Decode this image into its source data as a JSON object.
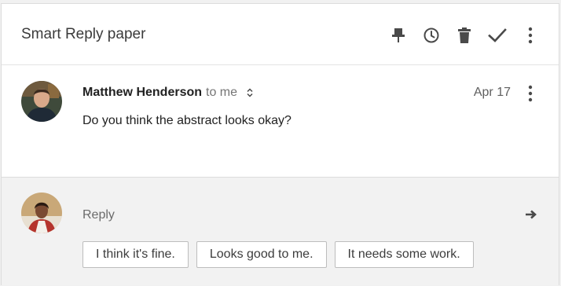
{
  "thread": {
    "subject": "Smart Reply paper"
  },
  "toolbar": {
    "actions": [
      {
        "name": "pin",
        "icon": "pin-icon"
      },
      {
        "name": "snooze",
        "icon": "clock-icon"
      },
      {
        "name": "delete",
        "icon": "trash-icon"
      },
      {
        "name": "done",
        "icon": "checkmark-icon"
      },
      {
        "name": "more",
        "icon": "more-vertical-icon"
      }
    ]
  },
  "message": {
    "sender": "Matthew Henderson",
    "recipient": "to me",
    "date": "Apr 17",
    "body": "Do you think the abstract looks okay?",
    "expand_icon": "expand-toggle-icon",
    "more_icon": "more-vertical-icon"
  },
  "reply": {
    "label": "Reply",
    "send_icon": "send-arrow-icon",
    "suggestions": [
      "I think it's fine.",
      "Looks good to me.",
      "It needs some work."
    ]
  },
  "colors": {
    "page_background": "#f1f1f1",
    "card_background": "#ffffff",
    "reply_background": "#f2f2f2",
    "text_primary": "#212121",
    "text_secondary": "#757575",
    "icon": "#4a4a4a",
    "chip_border": "#bdbdbd"
  }
}
